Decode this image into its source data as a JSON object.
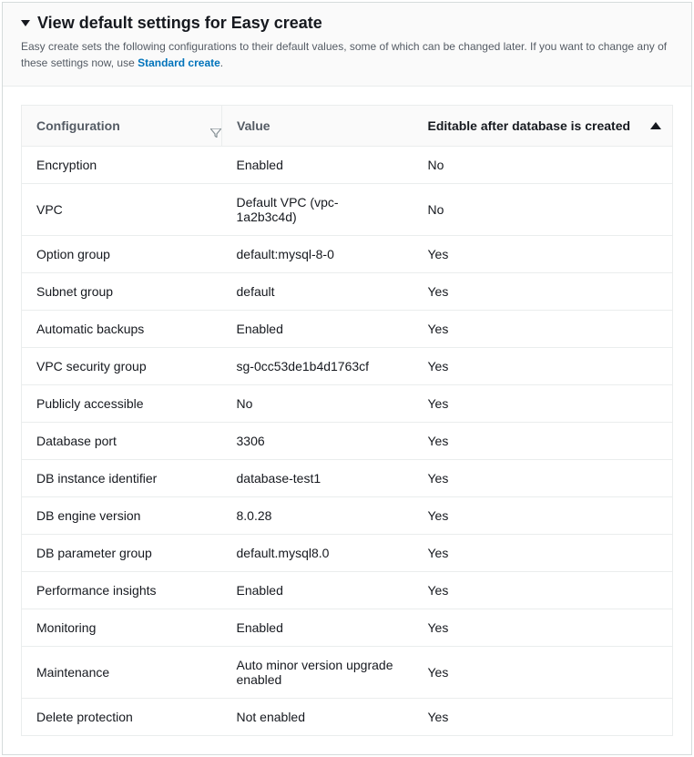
{
  "header": {
    "title": "View default settings for Easy create",
    "description_prefix": "Easy create sets the following configurations to their default values, some of which can be changed later. If you want to change any of these settings now, use ",
    "link_text": "Standard create",
    "description_suffix": "."
  },
  "table": {
    "columns": {
      "config": "Configuration",
      "value": "Value",
      "editable": "Editable after database is created"
    },
    "rows": [
      {
        "config": "Encryption",
        "value": "Enabled",
        "editable": "No"
      },
      {
        "config": "VPC",
        "value": "Default VPC (vpc-1a2b3c4d)",
        "editable": "No"
      },
      {
        "config": "Option group",
        "value": "default:mysql-8-0",
        "editable": "Yes"
      },
      {
        "config": "Subnet group",
        "value": "default",
        "editable": "Yes"
      },
      {
        "config": "Automatic backups",
        "value": "Enabled",
        "editable": "Yes"
      },
      {
        "config": "VPC security group",
        "value": "sg-0cc53de1b4d1763cf",
        "editable": "Yes"
      },
      {
        "config": "Publicly accessible",
        "value": "No",
        "editable": "Yes"
      },
      {
        "config": "Database port",
        "value": "3306",
        "editable": "Yes"
      },
      {
        "config": "DB instance identifier",
        "value": "database-test1",
        "editable": "Yes"
      },
      {
        "config": "DB engine version",
        "value": "8.0.28",
        "editable": "Yes"
      },
      {
        "config": "DB parameter group",
        "value": "default.mysql8.0",
        "editable": "Yes"
      },
      {
        "config": "Performance insights",
        "value": "Enabled",
        "editable": "Yes"
      },
      {
        "config": "Monitoring",
        "value": "Enabled",
        "editable": "Yes"
      },
      {
        "config": "Maintenance",
        "value": "Auto minor version upgrade enabled",
        "editable": "Yes"
      },
      {
        "config": "Delete protection",
        "value": "Not enabled",
        "editable": "Yes"
      }
    ]
  }
}
